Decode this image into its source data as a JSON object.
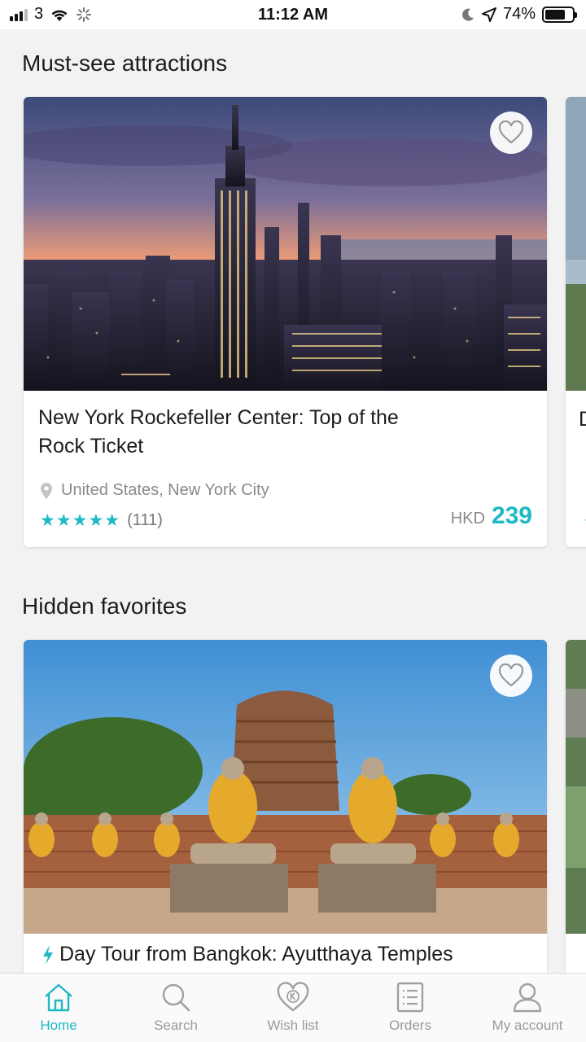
{
  "status_bar": {
    "carrier": "3",
    "time": "11:12 AM",
    "battery": "74%",
    "battery_level": 0.74
  },
  "sections": [
    {
      "title": "Must-see attractions",
      "card": {
        "title": "New York Rockefeller Center: Top of the Rock Ticket",
        "location": "United States, New York City",
        "stars": "★★★★★",
        "rating_value": 5,
        "review_count": "(111)",
        "currency": "HKD",
        "price": "239",
        "peek_letter": "D"
      }
    },
    {
      "title": "Hidden favorites",
      "card": {
        "title": "Day Tour from Bangkok: Ayutthaya Temples"
      }
    }
  ],
  "tabs": [
    {
      "label": "Home",
      "icon": "home-icon",
      "active": true
    },
    {
      "label": "Search",
      "icon": "search-icon",
      "active": false
    },
    {
      "label": "Wish list",
      "icon": "wishlist-heart-icon",
      "active": false
    },
    {
      "label": "Orders",
      "icon": "orders-icon",
      "active": false
    },
    {
      "label": "My account",
      "icon": "account-icon",
      "active": false
    }
  ],
  "colors": {
    "accent": "#1fb9c3",
    "background": "#f2f2f2",
    "tab_inactive": "#9a9a9a"
  }
}
